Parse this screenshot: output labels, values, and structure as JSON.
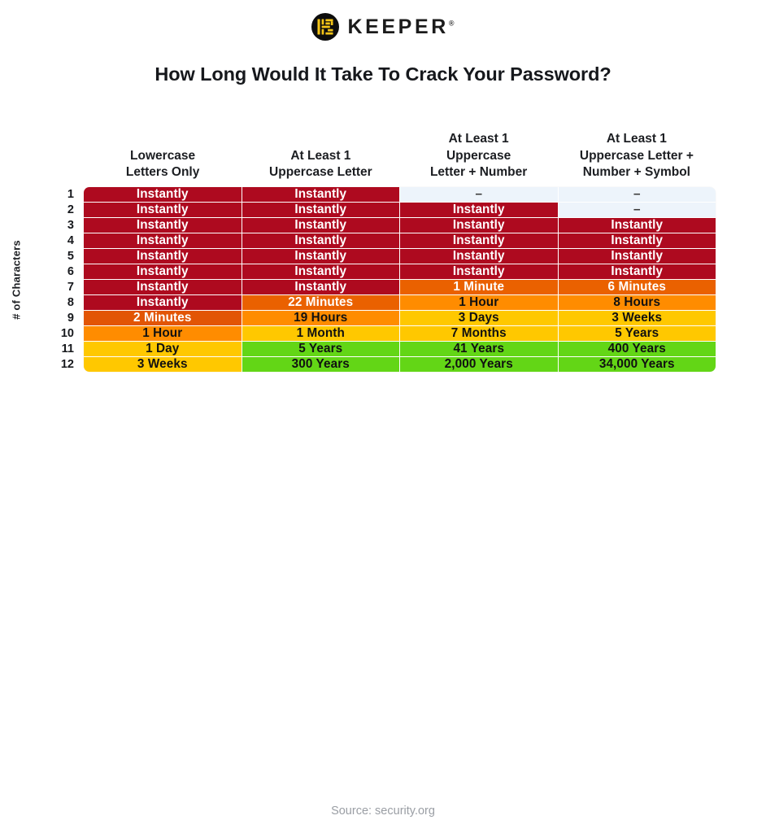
{
  "brand": {
    "name": "KEEPER",
    "registered_mark": "®",
    "logo_icon": "keeper-logo-icon",
    "logo_bg": "#0d0d0d",
    "logo_fg": "#f5c518"
  },
  "title": "How Long Would It Take To Crack Your Password?",
  "axis": {
    "y_label": "# of Characters"
  },
  "source": "Source: security.org",
  "colors": {
    "instant_red": "#AE0A1F",
    "dark_orange": "#E25505",
    "orange": "#EF6100",
    "light_orange": "#FF8C00",
    "gold": "#FFC800",
    "green": "#63D616",
    "none_blue": "#EDF4FB",
    "text_light": "#FFFFFF",
    "text_dark": "#111111",
    "dash_gray": "#3a3a3a"
  },
  "chart_data": {
    "type": "heatmap",
    "title": "How Long Would It Take To Crack Your Password?",
    "xlabel": "",
    "ylabel": "# of Characters",
    "grid": true,
    "legend": "none",
    "categories": [
      "Lowercase\nLetters Only",
      "At Least 1\nUppercase Letter",
      "At Least 1\nUppercase\nLetter  +  Number",
      "At Least 1\nUppercase Letter +\nNumber + Symbol"
    ],
    "row_labels": [
      "1",
      "2",
      "3",
      "4",
      "5",
      "6",
      "7",
      "8",
      "9",
      "10",
      "11",
      "12"
    ],
    "rows": [
      {
        "label": "1",
        "cells": [
          {
            "text": "Instantly",
            "color": "#AE0A1F",
            "fg": "#FFFFFF"
          },
          {
            "text": "Instantly",
            "color": "#AE0A1F",
            "fg": "#FFFFFF"
          },
          {
            "text": "–",
            "color": "#EDF4FB",
            "fg": "#3a3a3a"
          },
          {
            "text": "–",
            "color": "#EDF4FB",
            "fg": "#3a3a3a"
          }
        ]
      },
      {
        "label": "2",
        "cells": [
          {
            "text": "Instantly",
            "color": "#AE0A1F",
            "fg": "#FFFFFF"
          },
          {
            "text": "Instantly",
            "color": "#AE0A1F",
            "fg": "#FFFFFF"
          },
          {
            "text": "Instantly",
            "color": "#AE0A1F",
            "fg": "#FFFFFF"
          },
          {
            "text": "–",
            "color": "#EDF4FB",
            "fg": "#3a3a3a"
          }
        ]
      },
      {
        "label": "3",
        "cells": [
          {
            "text": "Instantly",
            "color": "#AE0A1F",
            "fg": "#FFFFFF"
          },
          {
            "text": "Instantly",
            "color": "#AE0A1F",
            "fg": "#FFFFFF"
          },
          {
            "text": "Instantly",
            "color": "#AE0A1F",
            "fg": "#FFFFFF"
          },
          {
            "text": "Instantly",
            "color": "#AE0A1F",
            "fg": "#FFFFFF"
          }
        ]
      },
      {
        "label": "4",
        "cells": [
          {
            "text": "Instantly",
            "color": "#AE0A1F",
            "fg": "#FFFFFF"
          },
          {
            "text": "Instantly",
            "color": "#AE0A1F",
            "fg": "#FFFFFF"
          },
          {
            "text": "Instantly",
            "color": "#AE0A1F",
            "fg": "#FFFFFF"
          },
          {
            "text": "Instantly",
            "color": "#AE0A1F",
            "fg": "#FFFFFF"
          }
        ]
      },
      {
        "label": "5",
        "cells": [
          {
            "text": "Instantly",
            "color": "#AE0A1F",
            "fg": "#FFFFFF"
          },
          {
            "text": "Instantly",
            "color": "#AE0A1F",
            "fg": "#FFFFFF"
          },
          {
            "text": "Instantly",
            "color": "#AE0A1F",
            "fg": "#FFFFFF"
          },
          {
            "text": "Instantly",
            "color": "#AE0A1F",
            "fg": "#FFFFFF"
          }
        ]
      },
      {
        "label": "6",
        "cells": [
          {
            "text": "Instantly",
            "color": "#AE0A1F",
            "fg": "#FFFFFF"
          },
          {
            "text": "Instantly",
            "color": "#AE0A1F",
            "fg": "#FFFFFF"
          },
          {
            "text": "Instantly",
            "color": "#AE0A1F",
            "fg": "#FFFFFF"
          },
          {
            "text": "Instantly",
            "color": "#AE0A1F",
            "fg": "#FFFFFF"
          }
        ]
      },
      {
        "label": "7",
        "cells": [
          {
            "text": "Instantly",
            "color": "#AE0A1F",
            "fg": "#FFFFFF"
          },
          {
            "text": "Instantly",
            "color": "#AE0A1F",
            "fg": "#FFFFFF"
          },
          {
            "text": "1 Minute",
            "color": "#EA6100",
            "fg": "#FFFFFF"
          },
          {
            "text": "6 Minutes",
            "color": "#EA6100",
            "fg": "#FFFFFF"
          }
        ]
      },
      {
        "label": "8",
        "cells": [
          {
            "text": "Instantly",
            "color": "#AE0A1F",
            "fg": "#FFFFFF"
          },
          {
            "text": "22 Minutes",
            "color": "#EA6100",
            "fg": "#FFFFFF"
          },
          {
            "text": "1 Hour",
            "color": "#FF8C00",
            "fg": "#111111"
          },
          {
            "text": "8 Hours",
            "color": "#FF8C00",
            "fg": "#111111"
          }
        ]
      },
      {
        "label": "9",
        "cells": [
          {
            "text": "2 Minutes",
            "color": "#E25505",
            "fg": "#FFFFFF"
          },
          {
            "text": "19 Hours",
            "color": "#FF8C00",
            "fg": "#111111"
          },
          {
            "text": "3 Days",
            "color": "#FFC800",
            "fg": "#111111"
          },
          {
            "text": "3 Weeks",
            "color": "#FFC800",
            "fg": "#111111"
          }
        ]
      },
      {
        "label": "10",
        "cells": [
          {
            "text": "1 Hour",
            "color": "#FF8C00",
            "fg": "#111111"
          },
          {
            "text": "1 Month",
            "color": "#FFC800",
            "fg": "#111111"
          },
          {
            "text": "7 Months",
            "color": "#FFC800",
            "fg": "#111111"
          },
          {
            "text": "5 Years",
            "color": "#FFC800",
            "fg": "#111111"
          }
        ]
      },
      {
        "label": "11",
        "cells": [
          {
            "text": "1 Day",
            "color": "#FFC800",
            "fg": "#111111"
          },
          {
            "text": "5 Years",
            "color": "#63D616",
            "fg": "#111111"
          },
          {
            "text": "41 Years",
            "color": "#63D616",
            "fg": "#111111"
          },
          {
            "text": "400 Years",
            "color": "#63D616",
            "fg": "#111111"
          }
        ]
      },
      {
        "label": "12",
        "cells": [
          {
            "text": "3 Weeks",
            "color": "#FFC800",
            "fg": "#111111"
          },
          {
            "text": "300 Years",
            "color": "#63D616",
            "fg": "#111111"
          },
          {
            "text": "2,000 Years",
            "color": "#63D616",
            "fg": "#111111"
          },
          {
            "text": "34,000 Years",
            "color": "#63D616",
            "fg": "#111111"
          }
        ]
      }
    ]
  }
}
